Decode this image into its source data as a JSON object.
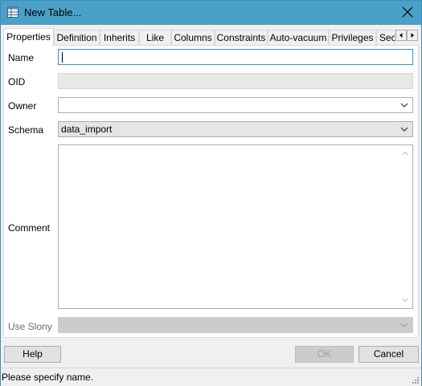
{
  "window": {
    "title": "New Table...",
    "close_glyph": "✕"
  },
  "tabs": [
    {
      "label": "Properties",
      "active": true
    },
    {
      "label": "Definition"
    },
    {
      "label": "Inherits"
    },
    {
      "label": "Like"
    },
    {
      "label": "Columns"
    },
    {
      "label": "Constraints"
    },
    {
      "label": "Auto-vacuum"
    },
    {
      "label": "Privileges"
    },
    {
      "label": "Sec"
    }
  ],
  "tab_scroll": {
    "left": "◀",
    "right": "▶"
  },
  "form": {
    "name_label": "Name",
    "name_value": "",
    "oid_label": "OID",
    "oid_value": "",
    "owner_label": "Owner",
    "owner_value": "",
    "schema_label": "Schema",
    "schema_value": "data_import",
    "comment_label": "Comment",
    "comment_value": "",
    "use_slony_label": "Use Slony",
    "use_slony_value": ""
  },
  "buttons": {
    "help": "Help",
    "ok": "OK",
    "cancel": "Cancel"
  },
  "status": {
    "message": "Please specify name."
  },
  "colors": {
    "titlebar": "#4aa0c8",
    "focus_border": "#3c8fcf"
  }
}
